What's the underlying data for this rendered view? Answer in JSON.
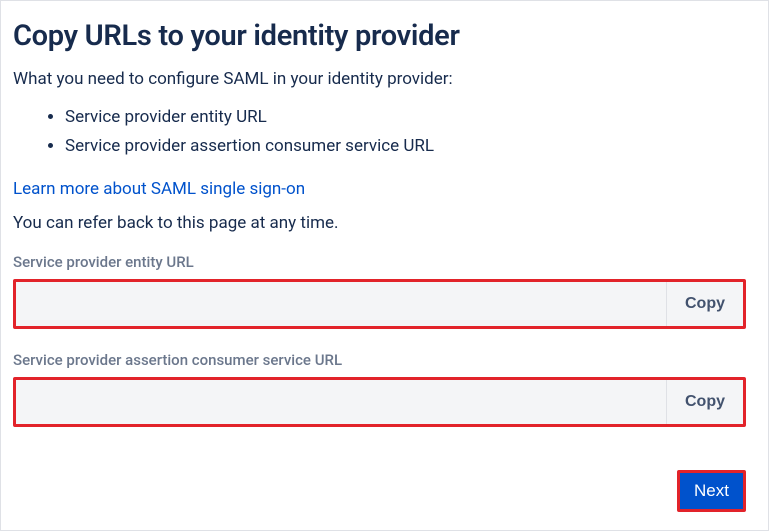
{
  "heading": "Copy URLs to your identity provider",
  "intro": "What you need to configure SAML in your identity provider:",
  "bullets": [
    "Service provider entity URL",
    "Service provider assertion consumer service URL"
  ],
  "learnMore": "Learn more about SAML single sign-on",
  "referBack": "You can refer back to this page at any time.",
  "fields": {
    "entity": {
      "label": "Service provider entity URL",
      "value": "",
      "copyLabel": "Copy"
    },
    "acs": {
      "label": "Service provider assertion consumer service URL",
      "value": "",
      "copyLabel": "Copy"
    }
  },
  "nextLabel": "Next"
}
